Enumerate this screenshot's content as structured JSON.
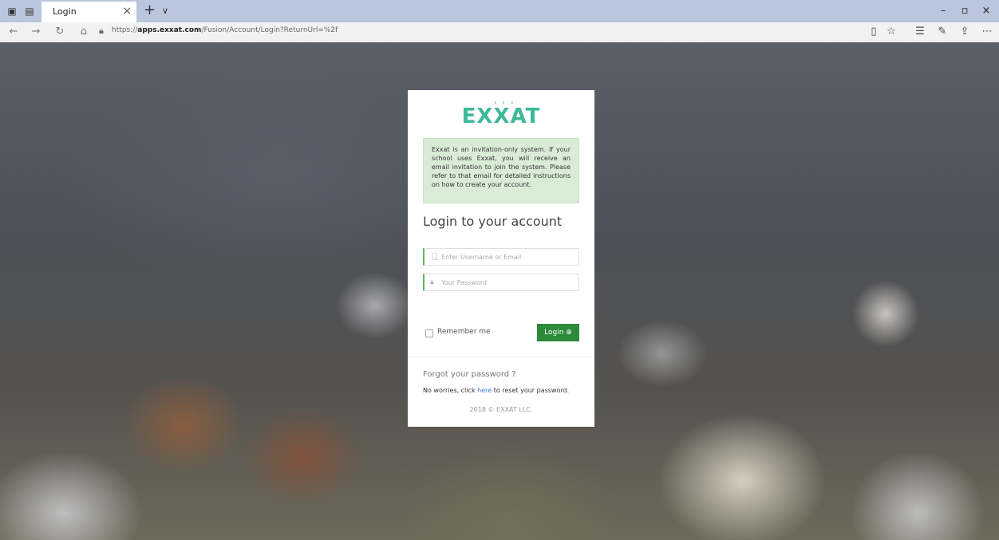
{
  "browser": {
    "tab_title": "Login",
    "tab_close": "×",
    "new_tab": "+",
    "tab_list": "∨",
    "url_prefix": "https://",
    "url_host": "apps.exxat.com",
    "url_path": "/Fusion/Account/Login?ReturnUrl=%2f",
    "window_minimize": "–",
    "window_restore": "▫",
    "window_close": "×"
  },
  "login": {
    "logo_text": "EXXAT",
    "notice": "Exxat is an invitation-only system. If your school uses Exxat, you will receive an email invitation to join the system. Please refer to that email for detailed instructions on how to create your account.",
    "heading": "Login to your account",
    "username_placeholder": "Enter Username or Email",
    "password_placeholder": "Your Password",
    "remember_label": "Remember me",
    "login_button": "Login ⊕",
    "forgot_heading": "Forgot your password ?",
    "noworries_prefix": "No worries, click ",
    "noworries_link": "here",
    "noworries_suffix": " to reset your password.",
    "copyright": "2018 © EXXAT LLC."
  },
  "colors": {
    "accent_green": "#2d8a3a",
    "logo_teal": "#3fb89a",
    "notice_bg": "#d9edd6",
    "link_blue": "#3a7bd5"
  }
}
